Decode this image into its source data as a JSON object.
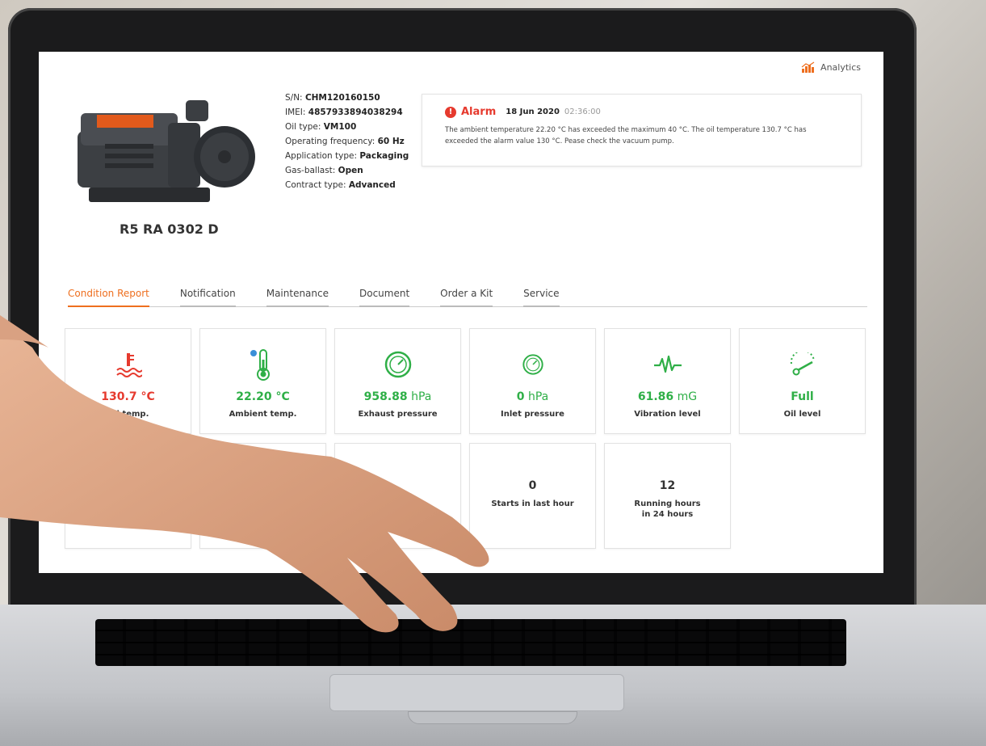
{
  "header": {
    "analytics_label": "Analytics"
  },
  "device": {
    "model": "R5 RA 0302 D",
    "specs": [
      {
        "label": "S/N: ",
        "value": "CHM120160150"
      },
      {
        "label": "IMEI: ",
        "value": "4857933894038294"
      },
      {
        "label": "Oil type: ",
        "value": "VM100"
      },
      {
        "label": "Operating frequency: ",
        "value": "60 Hz"
      },
      {
        "label": "Application type: ",
        "value": "Packaging"
      },
      {
        "label": "Gas-ballast: ",
        "value": "Open"
      },
      {
        "label": "Contract type: ",
        "value": "Advanced"
      }
    ]
  },
  "alarm": {
    "title": "Alarm",
    "date": "18 Jun 2020",
    "time": "02:36:00",
    "message": "The ambient temperature 22.20 °C has exceeded the maximum 40 °C. The oil temperature 130.7 °C has exceeded the alarm value 130 °C. Pease check the vacuum pump."
  },
  "tabs": [
    {
      "label": "Condition Report",
      "active": true
    },
    {
      "label": "Notification"
    },
    {
      "label": "Maintenance"
    },
    {
      "label": "Document"
    },
    {
      "label": "Order a Kit"
    },
    {
      "label": "Service"
    }
  ],
  "cards": [
    {
      "icon": "oil-temperature-icon",
      "value": "130.7 °C",
      "unit": "",
      "label": "Oil temp.",
      "status": "alert"
    },
    {
      "icon": "thermometer-icon",
      "value": "22.20 °C",
      "unit": "",
      "label": "Ambient temp.",
      "status": "ok"
    },
    {
      "icon": "gauge-icon",
      "value": "958.88",
      "unit": " hPa",
      "label": "Exhaust pressure",
      "status": "ok"
    },
    {
      "icon": "gauge-icon",
      "value": "0",
      "unit": " hPa",
      "label": "Inlet pressure",
      "status": "ok"
    },
    {
      "icon": "vibration-icon",
      "value": "61.86",
      "unit": " mG",
      "label": "Vibration level",
      "status": "ok"
    },
    {
      "icon": "oil-level-icon",
      "value": "Full",
      "unit": "",
      "label": "Oil level",
      "status": "ok"
    },
    {
      "value": "0",
      "label": "Starts in last hour"
    },
    {
      "value": "12",
      "label": "Running hours\nin 24 hours"
    }
  ],
  "colors": {
    "accent": "#ee6f1f",
    "alert": "#e63a2e",
    "ok": "#2faf47"
  }
}
